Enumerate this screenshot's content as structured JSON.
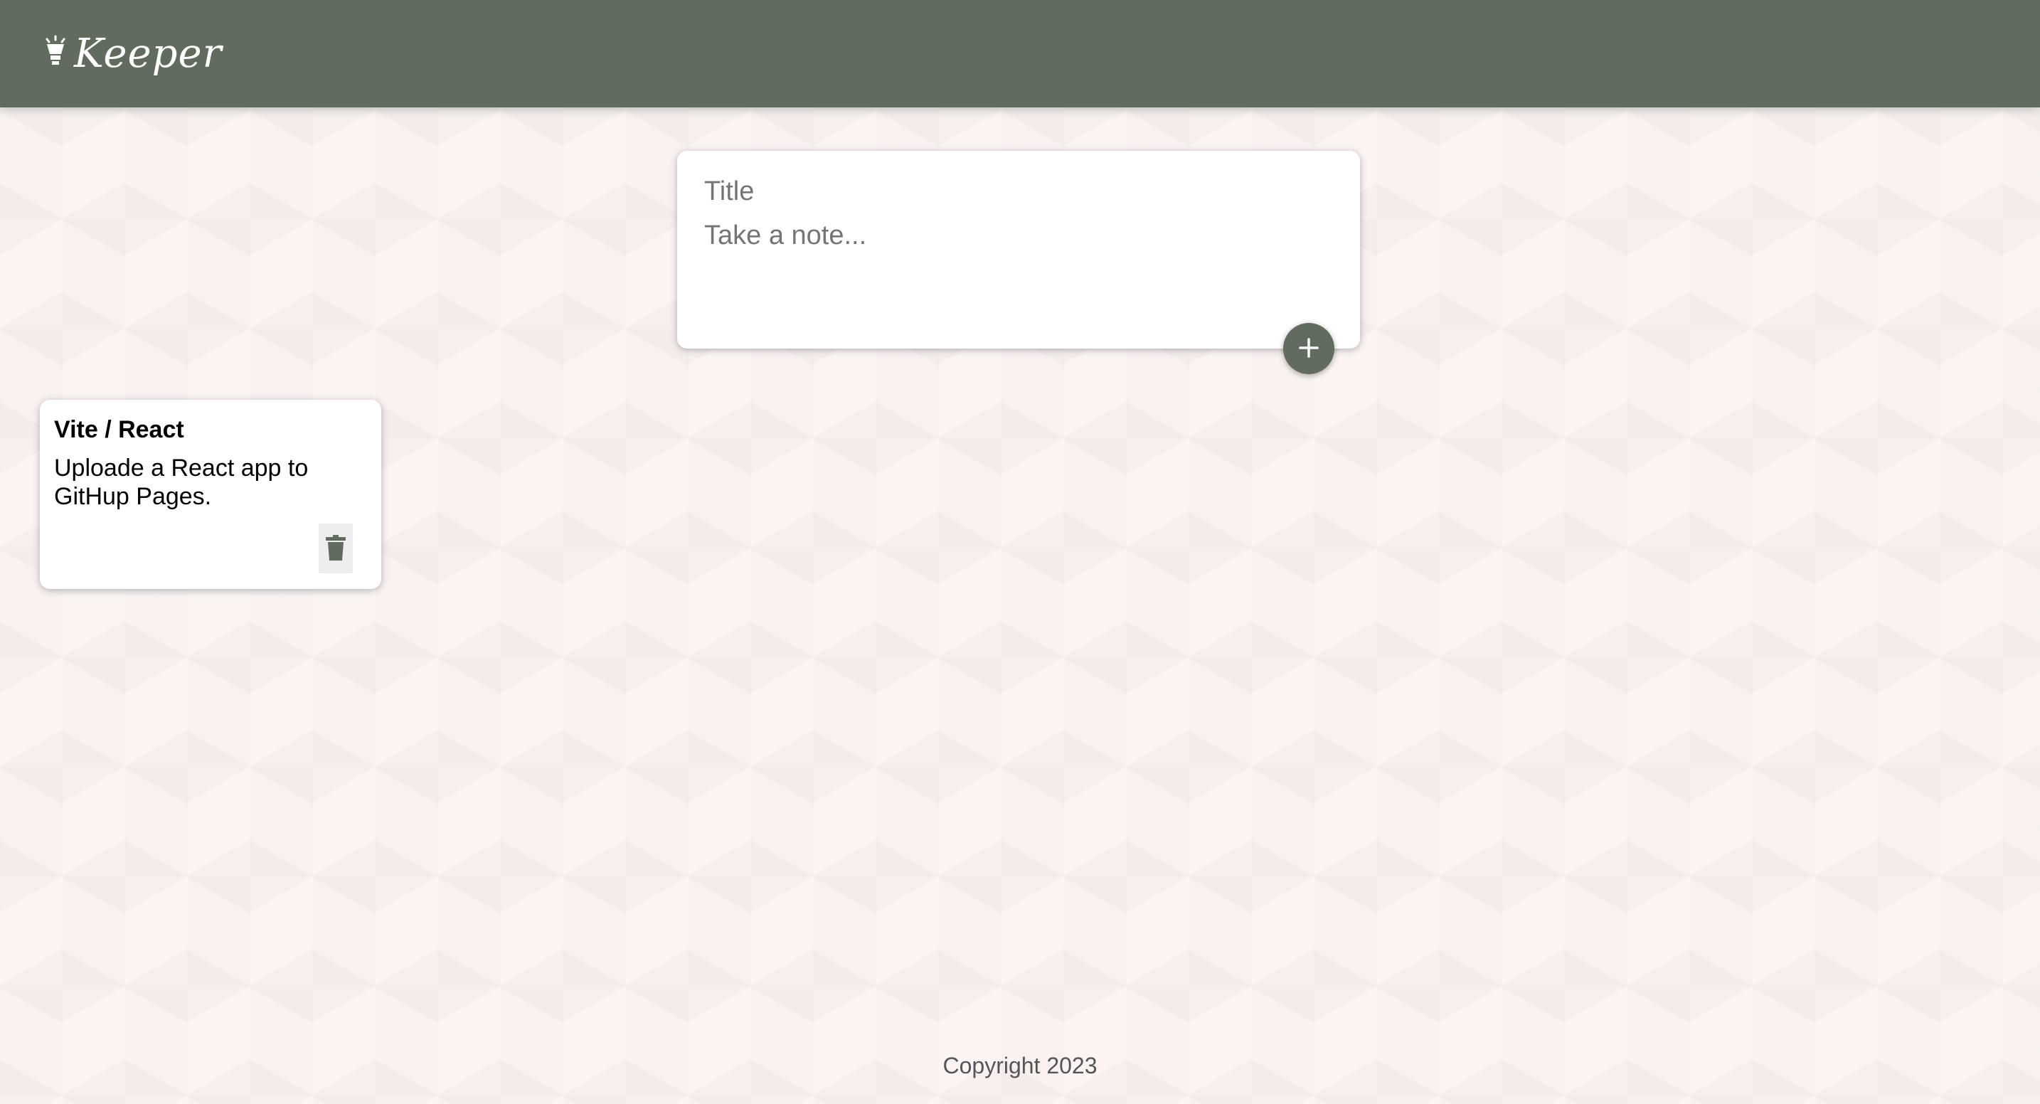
{
  "header": {
    "app_name": "Keeper",
    "logo_icon": "lightbulb-icon"
  },
  "composer": {
    "title_placeholder": "Title",
    "content_placeholder": "Take a note...",
    "title_value": "",
    "content_value": "",
    "add_icon": "plus-icon"
  },
  "notes": [
    {
      "title": "Vite / React",
      "content": "Uploade a React app to\nGitHup Pages.",
      "delete_icon": "trash-icon"
    }
  ],
  "footer": {
    "copyright": "Copyright 2023"
  },
  "colors": {
    "header_bg": "#626c5e",
    "page_bg": "#fbf4f3",
    "card_bg": "#ffffff",
    "accent": "#626c5e"
  }
}
